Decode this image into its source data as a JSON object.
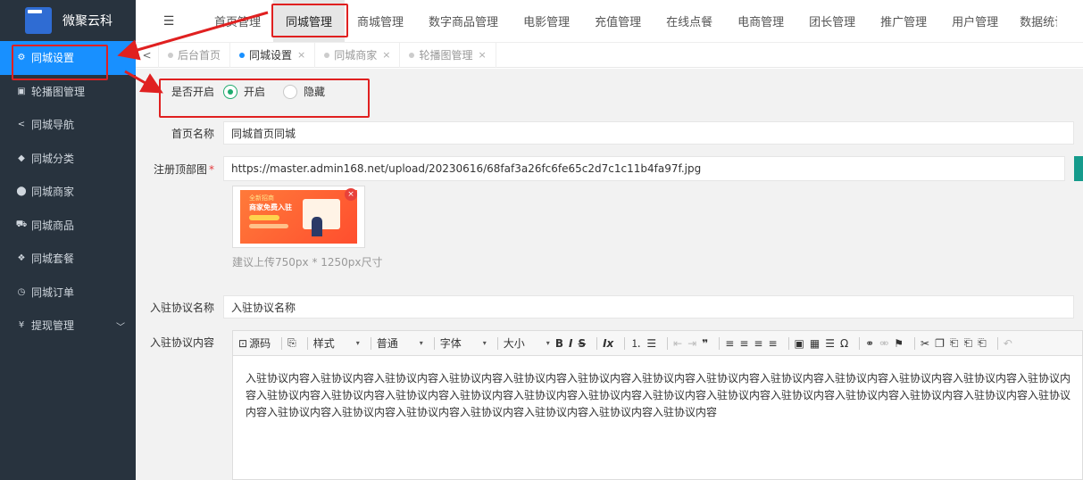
{
  "brand": {
    "name": "微聚云科"
  },
  "sidebar": {
    "items": [
      {
        "icon": "gear-icon",
        "glyph": "⚙",
        "label": "同城设置",
        "active": true
      },
      {
        "icon": "image-icon",
        "glyph": "▣",
        "label": "轮播图管理"
      },
      {
        "icon": "share-icon",
        "glyph": "<",
        "label": "同城导航"
      },
      {
        "icon": "tag-icon",
        "glyph": "◆",
        "label": "同城分类"
      },
      {
        "icon": "location-icon",
        "glyph": "⬤",
        "label": "同城商家"
      },
      {
        "icon": "cart-icon",
        "glyph": "⛟",
        "label": "同城商品"
      },
      {
        "icon": "package-icon",
        "glyph": "❖",
        "label": "同城套餐"
      },
      {
        "icon": "clock-icon",
        "glyph": "◷",
        "label": "同城订单"
      },
      {
        "icon": "yen-icon",
        "glyph": "¥",
        "label": "提现管理",
        "expandable": true
      }
    ]
  },
  "topnav": {
    "menu_glyph": "☰",
    "tabs": [
      "首页管理",
      "同城管理",
      "商城管理",
      "数字商品管理",
      "电影管理",
      "充值管理",
      "在线点餐",
      "电商管理",
      "团长管理",
      "推广管理",
      "用户管理",
      "数据统计"
    ],
    "active_index": 1
  },
  "page_tabs": {
    "back": "<",
    "items": [
      {
        "label": "后台首页",
        "closable": false
      },
      {
        "label": "同城设置",
        "closable": true,
        "active": true
      },
      {
        "label": "同城商家",
        "closable": true
      },
      {
        "label": "轮播图管理",
        "closable": true
      }
    ],
    "close_glyph": "×"
  },
  "form": {
    "open": {
      "label": "是否开启",
      "options": [
        "开启",
        "隐藏"
      ],
      "selected": 0
    },
    "home_name": {
      "label": "首页名称",
      "value": "同城首页同城"
    },
    "register_banner": {
      "label": "注册顶部图",
      "required_mark": "*",
      "value": "https://master.admin168.net/upload/20230616/68faf3a26fc6fe65c2d7c1c11b4fa97f.jpg",
      "hint": "建议上传750px * 1250px尺寸",
      "preview_text_1": "全新招商",
      "preview_text_2": "商家免费入驻",
      "remove_glyph": "×"
    },
    "agreement_name": {
      "label": "入驻协议名称",
      "value": "入驻协议名称"
    },
    "agreement_content": {
      "label": "入驻协议内容",
      "toolbar": {
        "source": "源码",
        "style": "样式",
        "format": "普通",
        "font": "字体",
        "size": "大小",
        "caret": "▾",
        "bold": "B",
        "italic": "I",
        "strike": "S",
        "clear": "Ix"
      },
      "body": "入驻协议内容入驻协议内容入驻协议内容入驻协议内容入驻协议内容入驻协议内容入驻协议内容入驻协议内容入驻协议内容入驻协议内容入驻协议内容入驻协议内容入驻协议内容入驻协议内容入驻协议内容入驻协议内容入驻协议内容入驻协议内容入驻协议内容入驻协议内容入驻协议内容入驻协议内容入驻协议内容入驻协议内容入驻协议内容入驻协议内容入驻协议内容入驻协议内容入驻协议内容入驻协议内容入驻协议内容入驻协议内容入驻协议内容"
    }
  },
  "colors": {
    "sidebar_bg": "#28333e",
    "active_blue": "#1890ff",
    "radio_green": "#1eab6e",
    "highlight_red": "#e02020"
  }
}
